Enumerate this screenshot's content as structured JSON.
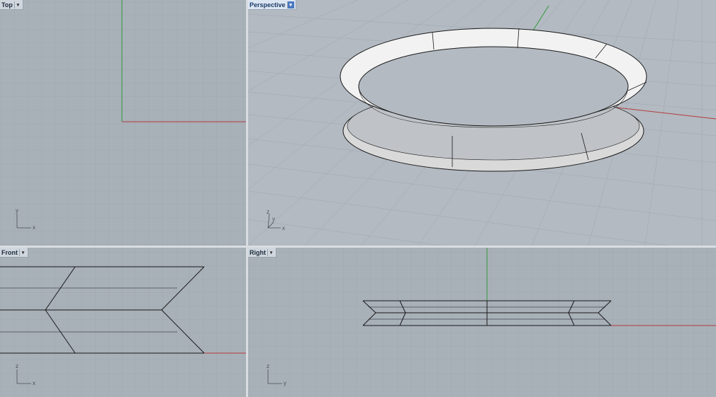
{
  "viewports": {
    "top": {
      "label": "Top",
      "axes": {
        "v": "y",
        "h": "x"
      }
    },
    "perspective": {
      "label": "Perspective",
      "axes": {
        "v": "z",
        "d": "y",
        "h": "x"
      }
    },
    "front": {
      "label": "Front",
      "axes": {
        "v": "z",
        "h": "x"
      }
    },
    "right": {
      "label": "Right",
      "axes": {
        "v": "z",
        "h": "y"
      }
    }
  },
  "icons": {
    "dropdown": "chevron-down-icon"
  },
  "colors": {
    "background": "#a8b0b8",
    "grid_minor": "#9aa2ab",
    "grid_major": "#8c959f",
    "x_axis": "#b43c3c",
    "y_axis": "#2f9a3a",
    "object": "#1a1a1a"
  }
}
